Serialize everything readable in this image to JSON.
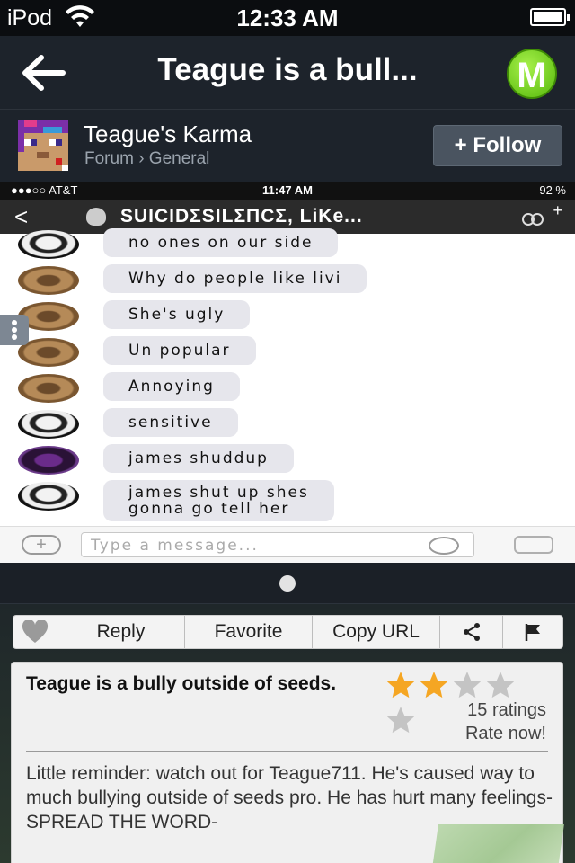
{
  "status_bar": {
    "carrier": "iPod",
    "time": "12:33 AM"
  },
  "nav": {
    "title": "Teague is a bull...",
    "badge_letter": "M"
  },
  "forum": {
    "name": "Teague's Karma",
    "crumb_forum": "Forum",
    "crumb_sep": "›",
    "crumb_category": "General",
    "follow_label": "+ Follow"
  },
  "embedded_screenshot": {
    "status_bar": {
      "carrier": "●●●○○ AT&T",
      "time": "11:47 AM",
      "battery": "92 %"
    },
    "chat_title": "SUICIDΣSILΣΠCΣ, LiKe...",
    "messages": [
      {
        "avatar": "skull",
        "text": "no ones on our side"
      },
      {
        "avatar": "brown",
        "text": "Why do people like livi"
      },
      {
        "avatar": "brown",
        "text": "She's ugly"
      },
      {
        "avatar": "brown",
        "text": "Un popular"
      },
      {
        "avatar": "brown",
        "text": "Annoying"
      },
      {
        "avatar": "skull",
        "text": "sensitive"
      },
      {
        "avatar": "purple",
        "text": "james shuddup"
      },
      {
        "avatar": "skull",
        "text": "james shut up shes\ngonna go tell her"
      }
    ],
    "input_placeholder": "Type a message..."
  },
  "actions": {
    "reply": "Reply",
    "favorite": "Favorite",
    "copy_url": "Copy URL"
  },
  "post": {
    "title": "Teague is a bully outside of seeds.",
    "rating_stars": 2,
    "rating_max": 5,
    "ratings_count": "15 ratings",
    "rate_now": "Rate now!",
    "body": "Little reminder: watch out for Teague711. He's caused way to much bullying outside of seeds pro. He has hurt many feelings- SPREAD THE WORD-"
  },
  "colors": {
    "accent_green": "#56b80b",
    "star_on": "#f5a623",
    "star_off": "#c4c4c4"
  }
}
